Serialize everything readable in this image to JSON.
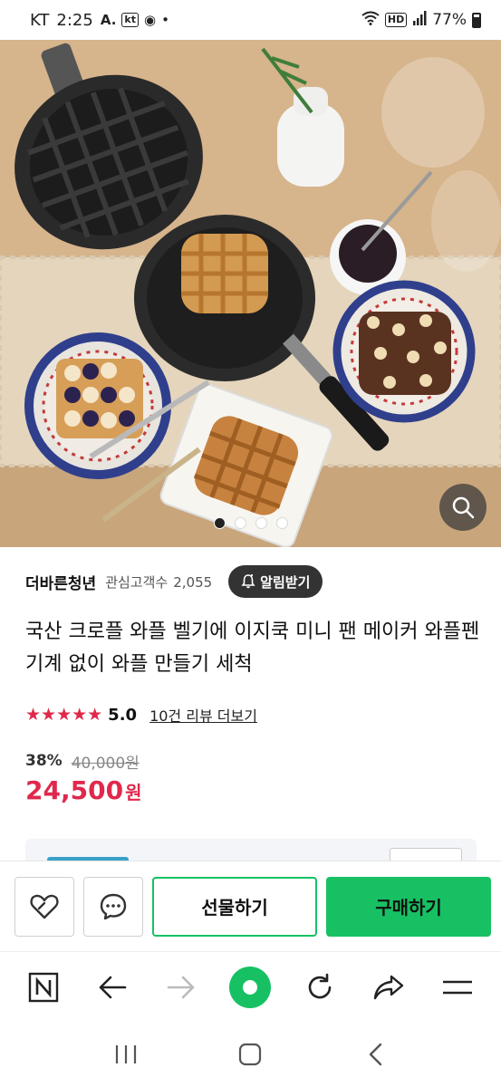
{
  "status_bar": {
    "carrier": "KT",
    "time": "2:25",
    "battery": "77%",
    "hd_label": "HD"
  },
  "hero": {
    "carousel_total": 4,
    "carousel_active": 1
  },
  "seller": {
    "name": "더바른청년",
    "fans_label": "관심고객수",
    "fans_count": "2,055",
    "alarm_label": "알림받기"
  },
  "product": {
    "title": "국산 크로플 와플 벨기에 이지쿡 미니 팬 메이커 와플펜 기계 없이 와플 만들기 세척",
    "rating_value": "5.0",
    "rating_stars": 5,
    "review_link": "10건 리뷰 더보기",
    "discount_rate": "38%",
    "original_price": "40,000원",
    "sale_price": "24,500",
    "price_unit": "원"
  },
  "actions": {
    "gift_label": "선물하기",
    "buy_label": "구매하기"
  },
  "icons": {
    "zoom": "search-icon",
    "like": "heart-icon",
    "talk": "chat-icon",
    "alarm": "bell-icon"
  },
  "colors": {
    "accent_green": "#17c163",
    "sale_red": "#e0284c"
  }
}
